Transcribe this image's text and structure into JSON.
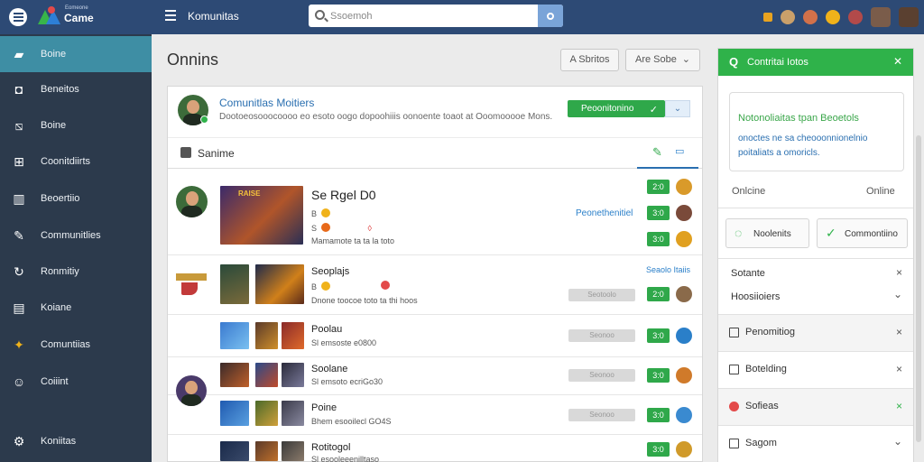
{
  "topbar": {
    "logo_small": "Eomeone",
    "logo_name": "Came",
    "title": "Komunitas",
    "search_placeholder": "Ssoemoh",
    "colors": {
      "bar": "#2d4a75",
      "accent": "#7aa4d8"
    }
  },
  "sidebar": {
    "items": [
      {
        "label": "Boine",
        "icon": "folder-icon",
        "glyph": "▰"
      },
      {
        "label": "Beneitos",
        "icon": "tag-icon",
        "glyph": "◘"
      },
      {
        "label": "Boine",
        "icon": "image-icon",
        "glyph": "⧅"
      },
      {
        "label": "Coonitdiirts",
        "icon": "grid-icon",
        "glyph": "⊞"
      },
      {
        "label": "Beoertiio",
        "icon": "chart-icon",
        "glyph": "▥"
      },
      {
        "label": "Communitlies",
        "icon": "pen-icon",
        "glyph": "✎"
      },
      {
        "label": "Ronmitiy",
        "icon": "link-icon",
        "glyph": "↻"
      },
      {
        "label": "Koiane",
        "icon": "table-icon",
        "glyph": "▤"
      },
      {
        "label": "Comuntiias",
        "icon": "community-icon",
        "glyph": "✦"
      },
      {
        "label": "Coiiint",
        "icon": "user-icon",
        "glyph": "☺"
      },
      {
        "label": "Koniitas",
        "icon": "gear-icon",
        "glyph": "⚙"
      }
    ],
    "active_index": 0
  },
  "main": {
    "title": "Onnins",
    "btn_a": "A Sbritos",
    "btn_b": "Are Sobe",
    "card": {
      "title": "Comunitlas Moitiers",
      "description": "Dootoeosooocoooo eo esoto oogo dopoohiiis oonoente toaot at Ooomooooe Mons.",
      "green_button": "Peoonitonino",
      "sub_label": "Sanime",
      "rows": [
        {
          "title": "Se Rgel D0",
          "lines": [
            "B",
            "S",
            "Mamamote ta ta la toto"
          ],
          "thumb_text": "RAISE",
          "link": "Peonethenitiel",
          "badges": [
            "2:0",
            "3:0",
            "3:0"
          ]
        },
        {
          "title": "Seoplajs",
          "lines": [
            "B",
            "Dnone toocoe toto ta thi hoos"
          ],
          "link": "Seaolo Itaiis",
          "badges": [
            "2:0"
          ],
          "pill": "Seotoolo"
        },
        {
          "title": "Poolau",
          "lines": [
            "Sl emsoste e0800"
          ],
          "badges": [
            "3:0"
          ],
          "pill": "Seonoo"
        },
        {
          "title": "Soolane",
          "lines": [
            "Sl emsoto ecriGo30"
          ],
          "badges": [
            "3:0"
          ],
          "pill": "Seonoo"
        },
        {
          "title": "Poine",
          "lines": [
            "Bhem esooilecl GO4S"
          ],
          "badges": [
            "3:0"
          ],
          "pill": "Seonoo"
        },
        {
          "title": "Rotitogol",
          "lines": [
            "Sl esooleeenilltaso"
          ],
          "badges": [
            "3:0"
          ]
        }
      ]
    }
  },
  "right_panel": {
    "header": "Contritai Iotos",
    "box_title": "Notonoliaitas tpan Beoetols",
    "box_text": "onoctes ne sa cheooonnionelnio poitaliats a omoricls.",
    "status_left": "Onlcine",
    "status_right": "Online",
    "btn_left": "Noolenits",
    "btn_right": "Commontiino",
    "rows": [
      {
        "label": "Sotante",
        "mark": "×"
      },
      {
        "label": "Hoosiioiers",
        "mark": "⌄"
      },
      {
        "label": "Penomitiog",
        "mark": "×"
      },
      {
        "label": "Botelding",
        "mark": "×"
      },
      {
        "label": "Sofieas",
        "mark": "×"
      },
      {
        "label": "Sagom",
        "mark": "⌄"
      }
    ],
    "colors": {
      "header": "#2fb24a"
    }
  }
}
